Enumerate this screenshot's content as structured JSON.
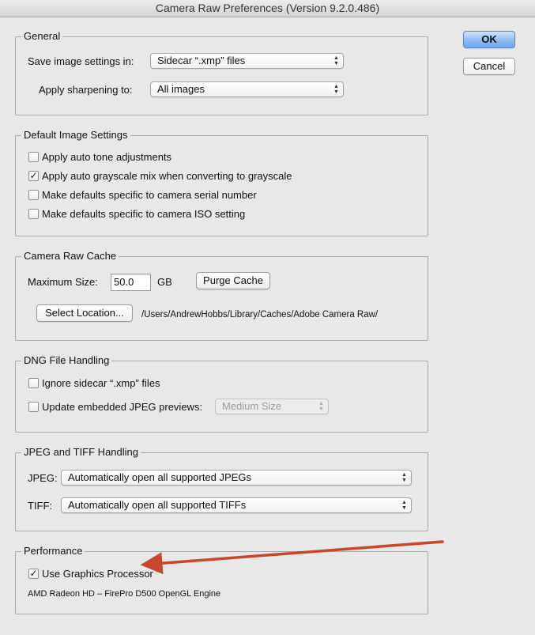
{
  "window": {
    "title": "Camera Raw Preferences  (Version 9.2.0.486)"
  },
  "buttons": {
    "ok": "OK",
    "cancel": "Cancel"
  },
  "general": {
    "legend": "General",
    "save_label": "Save image settings in:",
    "save_value": "Sidecar “.xmp” files",
    "sharpen_label": "Apply sharpening to:",
    "sharpen_value": "All images"
  },
  "defaults": {
    "legend": "Default Image Settings",
    "items": [
      {
        "label": "Apply auto tone adjustments",
        "checked": false
      },
      {
        "label": "Apply auto grayscale mix when converting to grayscale",
        "checked": true
      },
      {
        "label": "Make defaults specific to camera serial number",
        "checked": false
      },
      {
        "label": "Make defaults specific to camera ISO setting",
        "checked": false
      }
    ]
  },
  "cache": {
    "legend": "Camera Raw Cache",
    "max_label": "Maximum Size:",
    "max_value": "50.0",
    "unit": "GB",
    "purge_label": "Purge Cache",
    "select_label": "Select Location...",
    "path": "/Users/AndrewHobbs/Library/Caches/Adobe Camera Raw/"
  },
  "dng": {
    "legend": "DNG File Handling",
    "ignore_label": "Ignore sidecar “.xmp” files",
    "ignore_checked": false,
    "update_label": "Update embedded JPEG previews:",
    "update_checked": false,
    "preview_size": "Medium Size"
  },
  "jpeg_tiff": {
    "legend": "JPEG and TIFF Handling",
    "jpeg_label": "JPEG:",
    "jpeg_value": "Automatically open all supported JPEGs",
    "tiff_label": "TIFF:",
    "tiff_value": "Automatically open all supported TIFFs"
  },
  "performance": {
    "legend": "Performance",
    "gpu_label": "Use Graphics Processor",
    "gpu_checked": true,
    "gpu_name": "AMD Radeon HD – FirePro D500 OpenGL Engine"
  },
  "colors": {
    "annotation_arrow": "#c8462c",
    "default_button": "#8bbcf3"
  },
  "icons": {
    "checkmark": "✓",
    "select_arrows": "▲▼"
  }
}
